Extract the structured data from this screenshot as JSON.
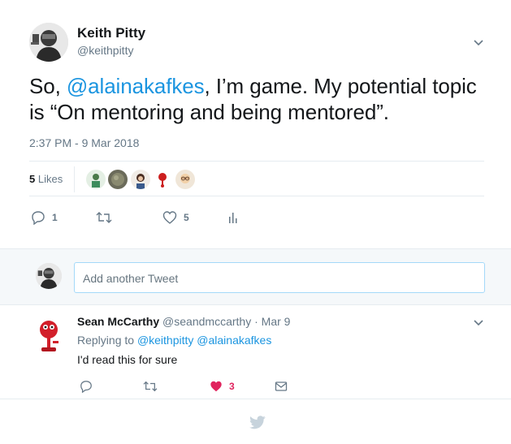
{
  "main_tweet": {
    "author_name": "Keith Pitty",
    "author_handle": "@keithpitty",
    "text_before": "So, ",
    "mention": "@alainakafkes",
    "text_after": ", I’m game. My potential topic is “On mentoring and being mentored”.",
    "timestamp": "2:37 PM - 9 Mar 2018",
    "likes_count": "5",
    "likes_label": "Likes",
    "actions": {
      "reply_icon": "reply-icon",
      "reply_count": "1",
      "retweet_icon": "retweet-icon",
      "like_icon": "heart-icon",
      "like_count": "5",
      "analytics_icon": "analytics-icon"
    }
  },
  "reply_box": {
    "placeholder": "Add another Tweet"
  },
  "reply_tweet": {
    "author_name": "Sean McCarthy",
    "author_handle": "@seandmccarthy",
    "separator": "·",
    "date": "Mar 9",
    "replying_label": "Replying to",
    "replying_mentions": "@keithpitty @alainakafkes",
    "text": "I'd read this for sure",
    "actions": {
      "like_count": "3",
      "like_color": "#e0245e"
    }
  },
  "colors": {
    "link": "#1b95e0",
    "secondary_text": "#657786",
    "border": "#e6ecf0",
    "background_alt": "#f5f8fa",
    "twitter_bird": "#c7d3dc"
  }
}
